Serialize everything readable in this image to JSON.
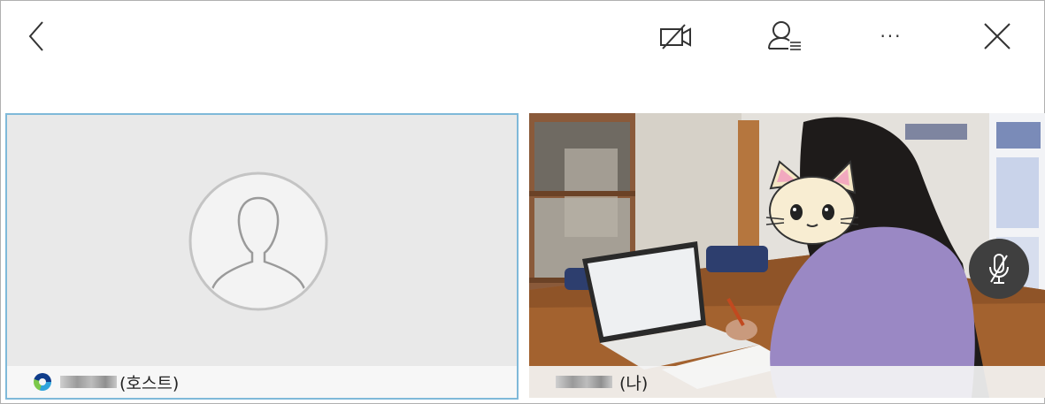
{
  "topbar": {
    "back_icon": "chevron-left-icon",
    "video_off_icon": "video-off-icon",
    "participants_icon": "participants-list-icon",
    "more_label": "···",
    "close_icon": "close-icon"
  },
  "tiles": [
    {
      "role": "host",
      "avatar_icon": "default-avatar-icon",
      "app_icon": "webex-icon",
      "suffix": "(호스트)",
      "highlight_color": "#7fb9d9"
    },
    {
      "role": "me",
      "suffix": "(나)",
      "mic_icon": "mic-muted-icon"
    }
  ]
}
